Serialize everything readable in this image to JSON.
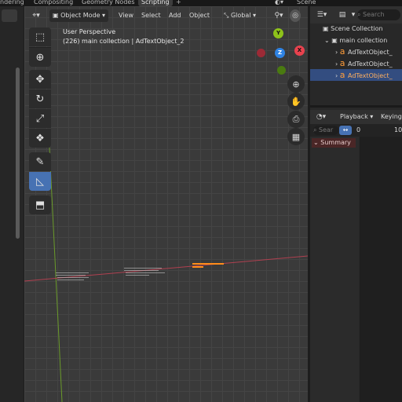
{
  "workspace_tabs": [
    "ndering",
    "Compositing",
    "Geometry Nodes",
    "Scripting"
  ],
  "active_tab": "Scripting",
  "add_tab_label": "+",
  "scene_label": "Scene",
  "viewport_header": {
    "mode": "Object Mode",
    "menus": [
      "View",
      "Select",
      "Add",
      "Object"
    ],
    "transform_orientation": "Global"
  },
  "viewport_overlay": {
    "perspective": "User Perspective",
    "info": "(226) main collection | AdTextObject_2"
  },
  "gizmo": {
    "y": "Y",
    "x": "X",
    "z": "Z"
  },
  "tools": [
    "select-box",
    "cursor",
    "move",
    "rotate",
    "scale",
    "transform",
    "annotate",
    "measure",
    "add-cube"
  ],
  "outliner": {
    "search_placeholder": "Search",
    "scene_collection": "Scene Collection",
    "collection": "main collection",
    "objects": [
      "AdTextObject_",
      "AdTextObject_",
      "AdTextObject_"
    ],
    "selected_index": 2
  },
  "timeline": {
    "playback": "Playback",
    "keying": "Keying",
    "search_placeholder": "Sear",
    "frame_start": "0",
    "frame_mark": "10",
    "summary": "Summary"
  },
  "colors": {
    "accent": "#4772b3",
    "axis_x": "#e8424e",
    "axis_y": "#8ec21a",
    "axis_z": "#2f83e3",
    "selected_text": "#ff8c1a"
  }
}
